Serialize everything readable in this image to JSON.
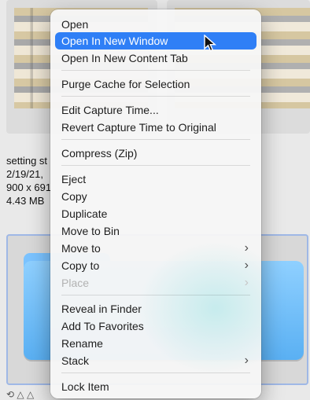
{
  "background": {
    "meta_lines": [
      "setting st",
      "2/19/21,",
      "900 x 691",
      "4.43 MB"
    ],
    "small_icons_text": "⟲ △ △"
  },
  "menu": {
    "items": [
      {
        "label": "Open",
        "selected": false,
        "disabled": false,
        "submenu": false
      },
      {
        "label": "Open In New Window",
        "selected": true,
        "disabled": false,
        "submenu": false
      },
      {
        "label": "Open In New Content Tab",
        "selected": false,
        "disabled": false,
        "submenu": false
      },
      {
        "label": "Purge Cache for Selection",
        "selected": false,
        "disabled": false,
        "submenu": false
      },
      {
        "label": "Edit Capture Time...",
        "selected": false,
        "disabled": false,
        "submenu": false
      },
      {
        "label": "Revert Capture Time to Original",
        "selected": false,
        "disabled": false,
        "submenu": false
      },
      {
        "label": "Compress (Zip)",
        "selected": false,
        "disabled": false,
        "submenu": false
      },
      {
        "label": "Eject",
        "selected": false,
        "disabled": false,
        "submenu": false
      },
      {
        "label": "Copy",
        "selected": false,
        "disabled": false,
        "submenu": false
      },
      {
        "label": "Duplicate",
        "selected": false,
        "disabled": false,
        "submenu": false
      },
      {
        "label": "Move to Bin",
        "selected": false,
        "disabled": false,
        "submenu": false
      },
      {
        "label": "Move to",
        "selected": false,
        "disabled": false,
        "submenu": true
      },
      {
        "label": "Copy to",
        "selected": false,
        "disabled": false,
        "submenu": true
      },
      {
        "label": "Place",
        "selected": false,
        "disabled": true,
        "submenu": true
      },
      {
        "label": "Reveal in Finder",
        "selected": false,
        "disabled": false,
        "submenu": false
      },
      {
        "label": "Add To Favorites",
        "selected": false,
        "disabled": false,
        "submenu": false
      },
      {
        "label": "Rename",
        "selected": false,
        "disabled": false,
        "submenu": false
      },
      {
        "label": "Stack",
        "selected": false,
        "disabled": false,
        "submenu": true
      },
      {
        "label": "Lock Item",
        "selected": false,
        "disabled": false,
        "submenu": false
      }
    ],
    "submenu_glyph": "›"
  },
  "colors": {
    "selection": "#2f7ff6",
    "menu_bg": "#f6f6f6",
    "disabled_text": "#b2b2b2",
    "folder_blue": "#5ab0f3"
  }
}
